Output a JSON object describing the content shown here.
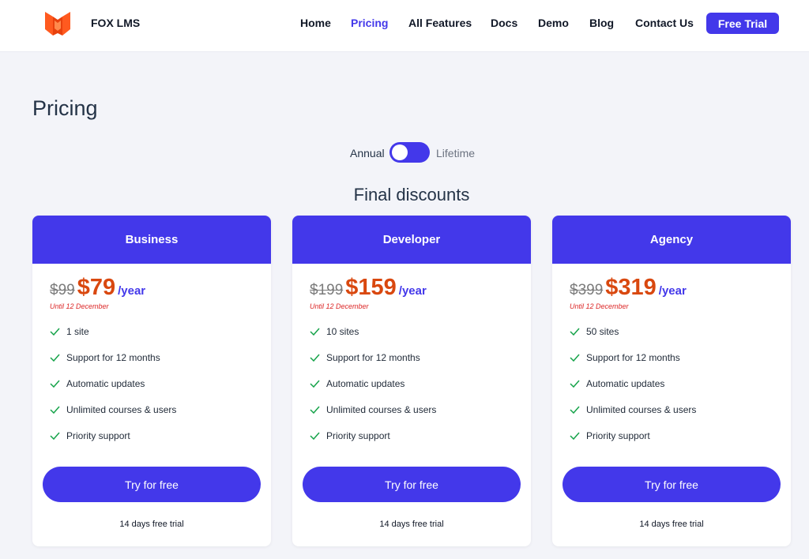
{
  "brand": {
    "name": "FOX LMS",
    "logo_icon": "fox-logo-icon",
    "logo_color": "#ff5a1f"
  },
  "nav": {
    "items": [
      {
        "label": "Home",
        "active": false
      },
      {
        "label": "Pricing",
        "active": true
      },
      {
        "label": "All Features",
        "active": false
      },
      {
        "label": "Docs",
        "active": false
      },
      {
        "label": "Demo",
        "active": false
      },
      {
        "label": "Blog",
        "active": false
      },
      {
        "label": "Contact Us",
        "active": false
      }
    ],
    "cta_label": "Free Trial"
  },
  "page": {
    "title": "Pricing",
    "toggle": {
      "left_label": "Annual",
      "right_label": "Lifetime",
      "selected": "Annual"
    },
    "section_title": "Final discounts"
  },
  "plans": [
    {
      "name": "Business",
      "old_price": "$99",
      "new_price": "$79",
      "period": "/year",
      "until": "Until 12 December",
      "features": [
        "1 site",
        "Support for 12 months",
        "Automatic updates",
        "Unlimited courses & users",
        "Priority support"
      ],
      "button_label": "Try for free",
      "trial_note": "14 days free trial"
    },
    {
      "name": "Developer",
      "old_price": "$199",
      "new_price": "$159",
      "period": "/year",
      "until": "Until 12 December",
      "features": [
        "10 sites",
        "Support for 12 months",
        "Automatic updates",
        "Unlimited courses & users",
        "Priority support"
      ],
      "button_label": "Try for free",
      "trial_note": "14 days free trial"
    },
    {
      "name": "Agency",
      "old_price": "$399",
      "new_price": "$319",
      "period": "/year",
      "until": "Until 12 December",
      "features": [
        "50 sites",
        "Support for 12 months",
        "Automatic updates",
        "Unlimited courses & users",
        "Priority support"
      ],
      "button_label": "Try for free",
      "trial_note": "14 days free trial"
    }
  ],
  "icons": {
    "feature": "check-icon"
  },
  "colors": {
    "accent": "#4338ea",
    "sale_price": "#d9480f",
    "until_text": "#dc2626",
    "check": "#16a34a",
    "background": "#f3f4f9"
  }
}
